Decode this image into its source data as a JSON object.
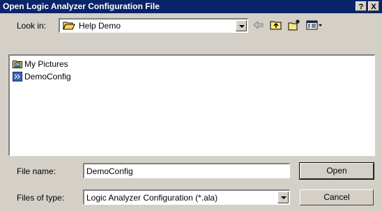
{
  "window": {
    "title": "Open Logic Analyzer Configuration File",
    "help_label": "?",
    "close_label": "X"
  },
  "look_in": {
    "label": "Look in:",
    "value": "Help Demo",
    "folder_icon": "folder-open-icon"
  },
  "toolbar": {
    "back_icon": "back-arrow-icon",
    "up_icon": "up-folder-icon",
    "new_folder_icon": "new-folder-icon",
    "views_icon": "views-menu-icon"
  },
  "files": [
    {
      "name": "My Pictures",
      "icon": "pictures-folder-icon"
    },
    {
      "name": "DemoConfig",
      "icon": "config-file-icon"
    }
  ],
  "file_name": {
    "label": "File name:",
    "value": "DemoConfig"
  },
  "file_type": {
    "label": "Files of type:",
    "value": "Logic Analyzer Configuration (*.ala)"
  },
  "buttons": {
    "open": "Open",
    "cancel": "Cancel"
  },
  "colors": {
    "titlebar": "#0a246a",
    "face": "#d4d0c8"
  }
}
